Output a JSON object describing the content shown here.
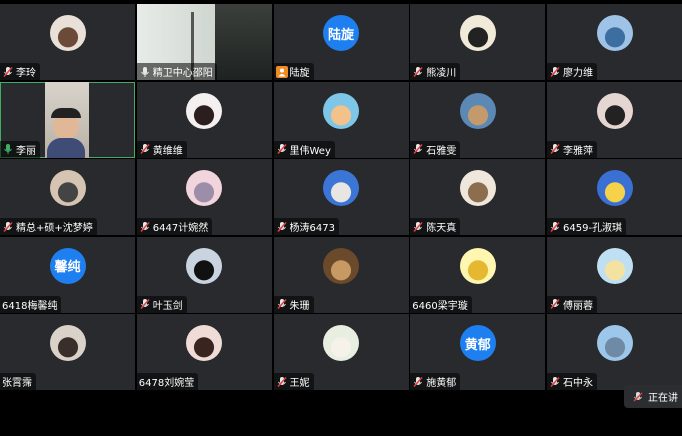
{
  "participants": [
    {
      "name": "李玲",
      "mic": "muted",
      "avatar": {
        "kind": "image",
        "icon": "girl-cartoon-avatar"
      }
    },
    {
      "name": "精卫中心邵阳",
      "mic": "on",
      "avatar": {
        "kind": "video",
        "icon": "window-room-video"
      }
    },
    {
      "name": "陆旋",
      "mic": "none",
      "avatar": {
        "kind": "text",
        "text": "陆旋"
      }
    },
    {
      "name": "熊凌川",
      "mic": "muted",
      "avatar": {
        "kind": "image",
        "icon": "panda-avatar"
      }
    },
    {
      "name": "廖力维",
      "mic": "muted",
      "avatar": {
        "kind": "image",
        "icon": "seaside-person-avatar"
      }
    },
    {
      "name": "李丽",
      "mic": "speaking",
      "active": true,
      "avatar": {
        "kind": "video",
        "icon": "webcam-person-video"
      }
    },
    {
      "name": "黄维维",
      "mic": "muted",
      "avatar": {
        "kind": "image",
        "icon": "cartoon-girl-avatar"
      }
    },
    {
      "name": "里伟Wey",
      "mic": "muted",
      "avatar": {
        "kind": "image",
        "icon": "glasses-cartoon-avatar"
      }
    },
    {
      "name": "石雅雯",
      "mic": "muted",
      "avatar": {
        "kind": "image",
        "icon": "outdoor-avatar"
      }
    },
    {
      "name": "李雅萍",
      "mic": "muted",
      "avatar": {
        "kind": "image",
        "icon": "girl-photo-avatar"
      }
    },
    {
      "name": "精总+硕+沈梦婷",
      "mic": "muted",
      "avatar": {
        "kind": "image",
        "icon": "group-photo-avatar"
      }
    },
    {
      "name": "6447计婉然",
      "mic": "muted",
      "avatar": {
        "kind": "image",
        "icon": "pink-room-avatar"
      }
    },
    {
      "name": "杨涛6473",
      "mic": "muted",
      "avatar": {
        "kind": "image",
        "icon": "sky-person-avatar"
      }
    },
    {
      "name": "陈天真",
      "mic": "muted",
      "avatar": {
        "kind": "image",
        "icon": "pug-dog-avatar"
      }
    },
    {
      "name": "6459-孔淑琪",
      "mic": "muted",
      "avatar": {
        "kind": "image",
        "icon": "cartoon-blue-avatar"
      }
    },
    {
      "name": "6418梅馨纯",
      "mic": "none",
      "avatar": {
        "kind": "text",
        "text": "馨纯"
      }
    },
    {
      "name": "叶玉剑",
      "mic": "muted",
      "avatar": {
        "kind": "image",
        "icon": "black-cat-avatar"
      }
    },
    {
      "name": "朱珊",
      "mic": "muted",
      "avatar": {
        "kind": "image",
        "icon": "brown-dog-avatar"
      }
    },
    {
      "name": "6460梁宇璇",
      "mic": "none",
      "avatar": {
        "kind": "image",
        "icon": "yellow-cartoon-avatar"
      }
    },
    {
      "name": "傅丽蓉",
      "mic": "muted",
      "avatar": {
        "kind": "image",
        "icon": "landscape-avatar"
      }
    },
    {
      "name": "张霄霈",
      "mic": "none",
      "avatar": {
        "kind": "image",
        "icon": "man-photo-avatar"
      }
    },
    {
      "name": "6478刘婉莹",
      "mic": "none",
      "avatar": {
        "kind": "image",
        "icon": "girl-portrait-avatar"
      }
    },
    {
      "name": "王妮",
      "mic": "muted",
      "avatar": {
        "kind": "image",
        "icon": "white-cat-avatar"
      }
    },
    {
      "name": "施黄郁",
      "mic": "muted",
      "avatar": {
        "kind": "text",
        "text": "黄郁"
      }
    },
    {
      "name": "石中永",
      "mic": "muted",
      "avatar": {
        "kind": "image",
        "icon": "coast-landscape-avatar"
      }
    }
  ],
  "status_pill": {
    "text": "正在讲",
    "icon": "muted-mic-icon"
  },
  "colors": {
    "tile": "#282a2e",
    "accent_blue": "#1e80f0",
    "active_border": "#3fae62",
    "mic_muted": "#e04040",
    "mic_on": "#3fae62"
  }
}
